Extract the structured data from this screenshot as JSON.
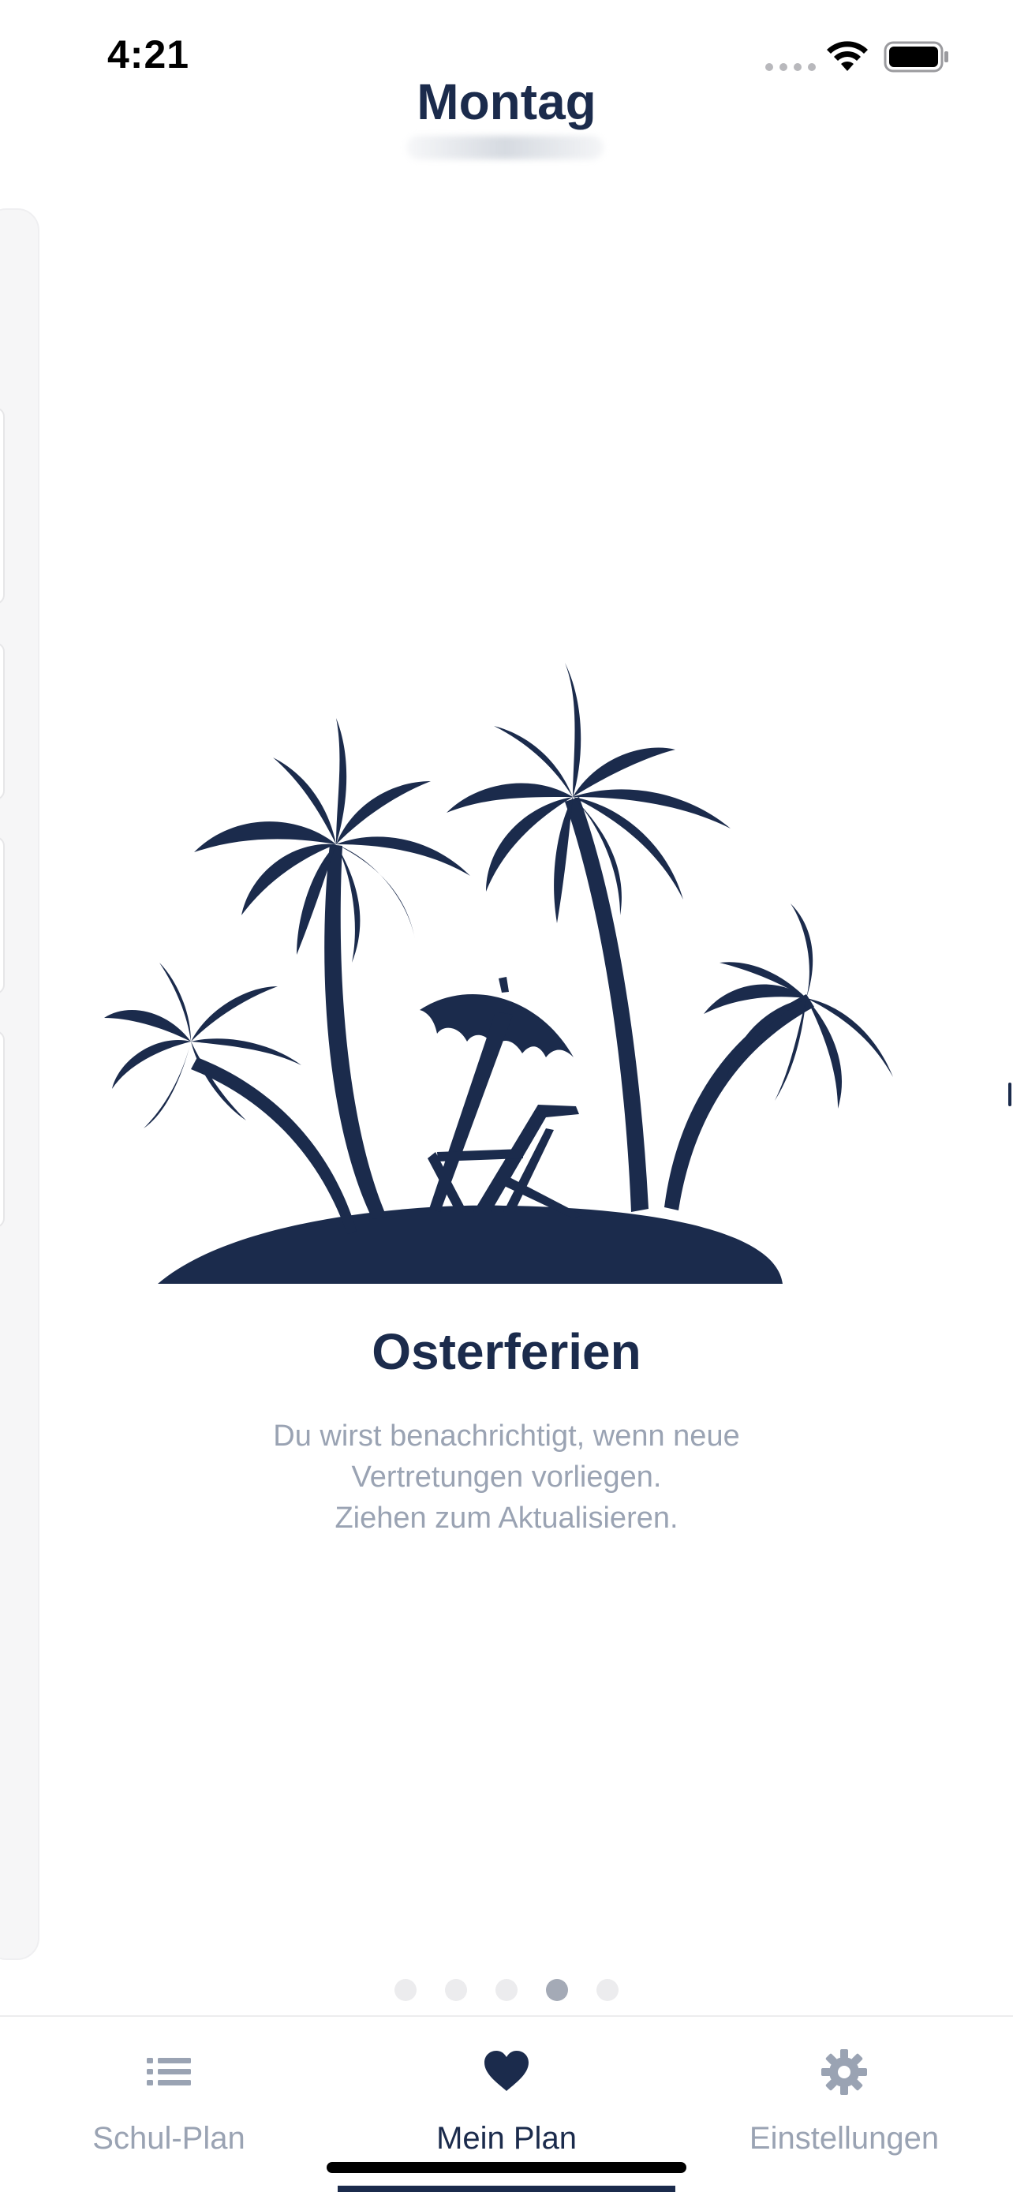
{
  "status_bar": {
    "time": "4:21"
  },
  "header": {
    "title": "Montag"
  },
  "empty_state": {
    "title": "Osterferien",
    "message_lines": [
      "Du wirst benachrichtigt, wenn neue",
      "Vertretungen vorliegen.",
      "Ziehen zum Aktualisieren."
    ],
    "illustration": "palm-island-beach-chair-illustration"
  },
  "pager": {
    "page_count": 5,
    "active_index": 3
  },
  "tab_bar": {
    "tabs": [
      {
        "label": "Schul-Plan",
        "icon": "list-icon",
        "active": false
      },
      {
        "label": "Mein Plan",
        "icon": "heart-icon",
        "active": true
      },
      {
        "label": "Einstellungen",
        "icon": "gear-icon",
        "active": false
      }
    ]
  },
  "colors": {
    "accent": "#1b2b4c",
    "muted_text": "#9aa3b3",
    "inactive_dot": "#ececee",
    "active_dot": "#a4aab6"
  }
}
